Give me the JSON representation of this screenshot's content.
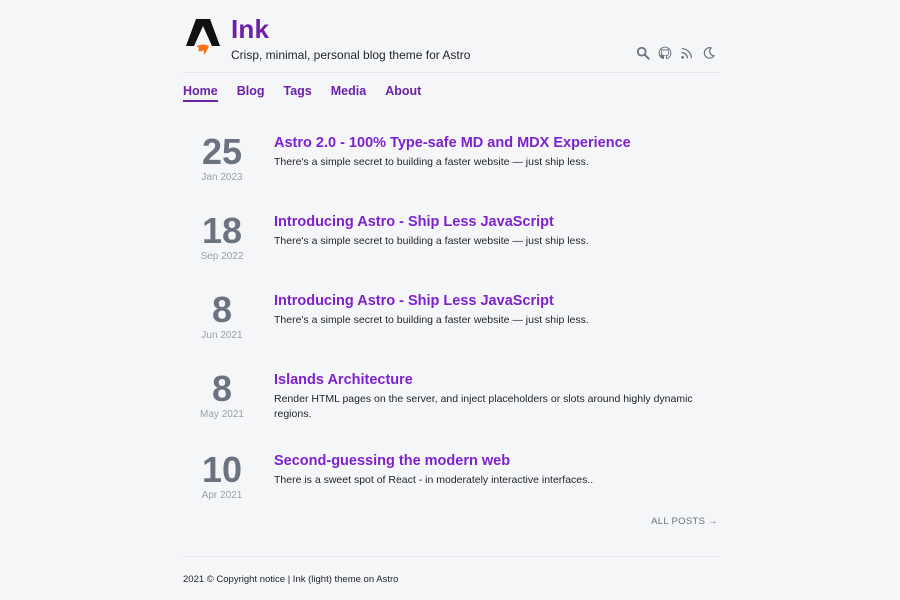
{
  "header": {
    "title": "Ink",
    "tagline": "Crisp, minimal, personal blog theme for Astro",
    "icons": [
      "search-icon",
      "github-icon",
      "rss-icon",
      "moon-icon"
    ]
  },
  "nav": {
    "items": [
      {
        "label": "Home",
        "active": true
      },
      {
        "label": "Blog",
        "active": false
      },
      {
        "label": "Tags",
        "active": false
      },
      {
        "label": "Media",
        "active": false
      },
      {
        "label": "About",
        "active": false
      }
    ]
  },
  "posts": [
    {
      "day": "25",
      "month": "Jan 2023",
      "title": "Astro 2.0 - 100% Type-safe MD and MDX Experience",
      "description": "There's a simple secret to building a faster website — just ship less."
    },
    {
      "day": "18",
      "month": "Sep 2022",
      "title": "Introducing Astro - Ship Less JavaScript",
      "description": "There's a simple secret to building a faster website — just ship less."
    },
    {
      "day": "8",
      "month": "Jun 2021",
      "title": "Introducing Astro - Ship Less JavaScript",
      "description": "There's a simple secret to building a faster website — just ship less."
    },
    {
      "day": "8",
      "month": "May 2021",
      "title": "Islands Architecture",
      "description": "Render HTML pages on the server, and inject placeholders or slots around highly dynamic regions."
    },
    {
      "day": "10",
      "month": "Apr 2021",
      "title": "Second-guessing the modern web",
      "description": "There is a sweet spot of React - in moderately interactive interfaces.."
    }
  ],
  "all_posts_label": "ALL POSTS →",
  "footer": {
    "text": "2021 © Copyright notice | Ink (light) theme on Astro"
  },
  "colors": {
    "accent": "#6b21a8",
    "link": "#7e22ce",
    "date": "#6c7380",
    "background": "#f5f6f8"
  }
}
